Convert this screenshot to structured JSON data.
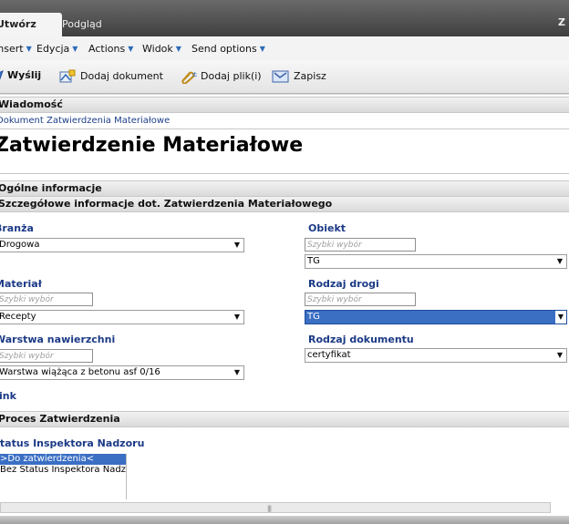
{
  "tabs": [
    {
      "label": "Utwórz"
    },
    {
      "label": "Podgląd"
    }
  ],
  "topbar_right": "Z",
  "menu": [
    {
      "label": "Insert"
    },
    {
      "label": "Edycja"
    },
    {
      "label": "Actions"
    },
    {
      "label": "Widok"
    },
    {
      "label": "Send options"
    }
  ],
  "toolbar": {
    "send": "Wyślij",
    "add_document": "Dodaj dokument",
    "add_files": "Dodaj plik(i)",
    "save": "Zapisz"
  },
  "message_section": "Wiadomość",
  "doc_type_line": "Dokument Zatwierdzenia Materiałowe",
  "page_title": "Zatwierdzenie Materiałowe",
  "general_section": "Ogólne informacje",
  "detail_section": "Szczegółowe informacje dot. Zatwierdzenia Materiałowego",
  "fields": {
    "branza": {
      "label": "Branża",
      "value": "Drogowa"
    },
    "obiekt": {
      "label": "Obiekt",
      "placeholder": "Szybki wybór",
      "value": "TG"
    },
    "material": {
      "label": "Materiał",
      "placeholder": "Szybki wybór",
      "value": "Recepty"
    },
    "rodzaj_drogi": {
      "label": "Rodzaj drogi",
      "placeholder": "Szybki wybór",
      "value": "TG"
    },
    "warstwa": {
      "label": "Warstwa nawierzchni",
      "placeholder": "Szybki wybór",
      "value": "Warstwa wiążąca z betonu asf 0/16"
    },
    "rodzaj_dok": {
      "label": "Rodzaj dokumentu",
      "value": "certyfikat"
    }
  },
  "link_label": "Link",
  "process_section": "Proces Zatwierdzenia",
  "status_label": "Status Inspektora Nadzoru",
  "status_options": [
    {
      "label": ">Do zatwierdzenia<",
      "selected": true
    },
    {
      "label": "Bez Status Inspektora Nadzoru",
      "selected": false
    }
  ],
  "colors": {
    "accent": "#1b3a86",
    "selection": "#3a6fc4"
  }
}
